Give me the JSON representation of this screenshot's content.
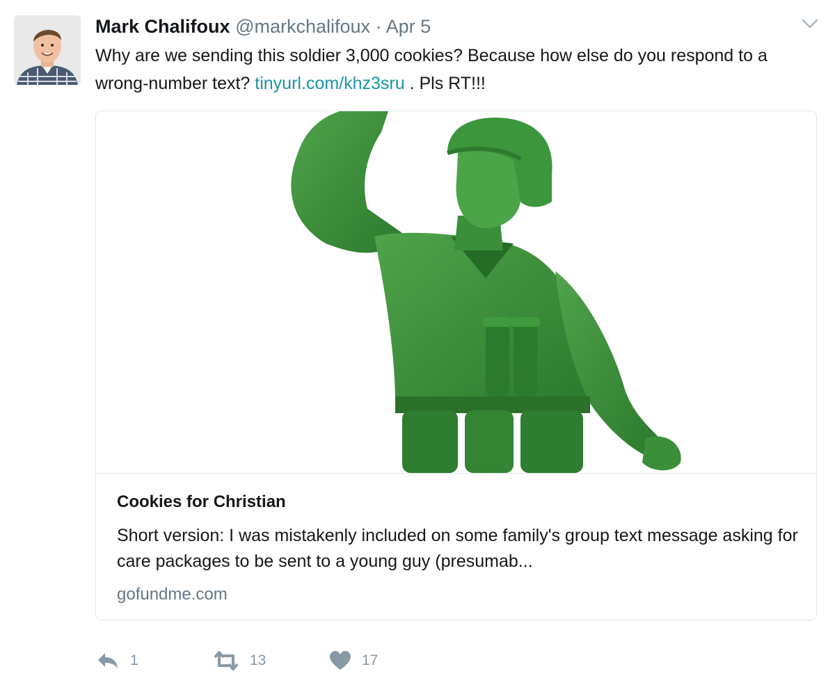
{
  "tweet": {
    "author_name": "Mark Chalifoux",
    "handle": "@markchalifoux",
    "separator": "·",
    "timestamp": "Apr 5",
    "text_before_link": "Why are we sending this soldier 3,000 cookies? Because how else do you respond to a wrong-number text?",
    "link_text": "tinyurl.com/khz3sru",
    "text_after_link": ". Pls RT!!!"
  },
  "card": {
    "title": "Cookies for Christian",
    "description": "Short version: I was mistakenly included on some family's group text message asking for care packages to be sent to a young guy (presumab...",
    "domain": "gofundme.com",
    "image_subject": "green plastic army man figurine"
  },
  "actions": {
    "reply_count": "1",
    "retweet_count": "13",
    "like_count": "17"
  },
  "colors": {
    "link": "#1b95a0",
    "secondary_text": "#657786",
    "action_icons": "#8899a6",
    "soldier_green": "#3a8f3a",
    "border": "#e1e8ed"
  },
  "icons": [
    "caret-down-icon",
    "reply-icon",
    "retweet-icon",
    "heart-icon"
  ]
}
